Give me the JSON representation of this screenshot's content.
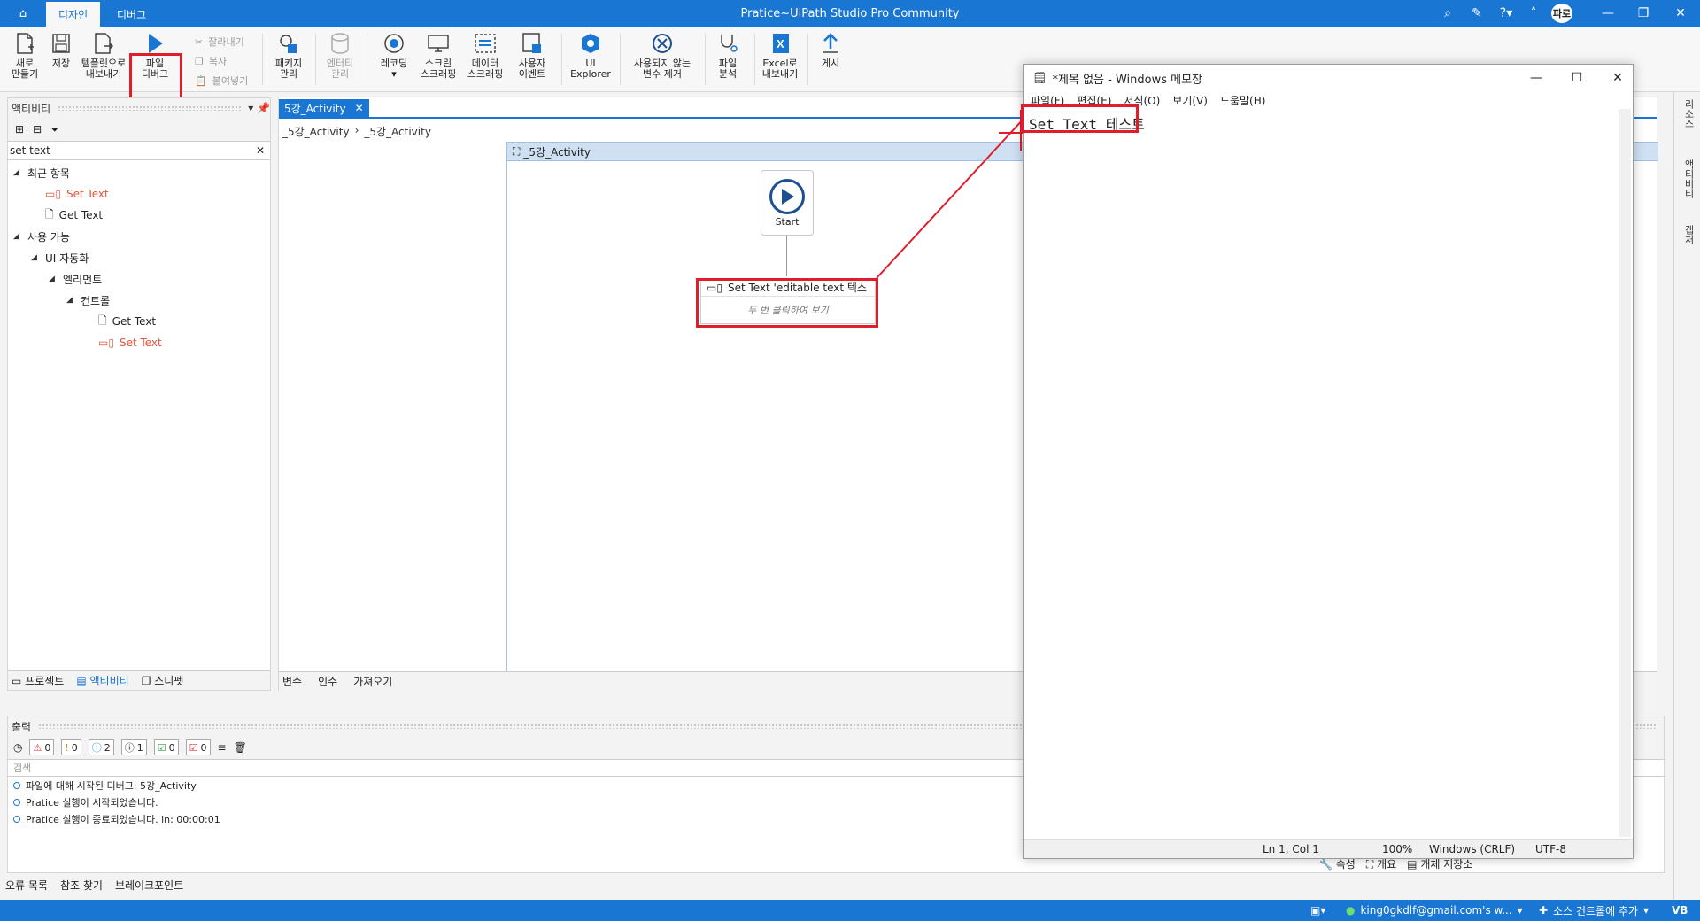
{
  "app": {
    "home_icon": "home-icon",
    "tabs": [
      "디자인",
      "디버그"
    ],
    "title": "Pratice~UiPath Studio Pro Community",
    "avatar": "파로"
  },
  "ribbon": {
    "new": "새로\n만들기",
    "save": "저장",
    "export_template": "템플릿으로\n내보내기",
    "debug_file": "파일\n디버그",
    "cut": "잘라내기",
    "copy": "복사",
    "paste": "붙여넣기",
    "manage_packages": "패키지\n관리",
    "manage_entities": "엔터티\n관리",
    "recording": "레코딩",
    "screen_scraping": "스크린\n스크래핑",
    "data_scraping": "데이터\n스크래핑",
    "user_events": "사용자\n이벤트",
    "ui_explorer": "UI\nExplorer",
    "remove_unused": "사용되지 않는\n변수 제거",
    "analyze_file": "파일\n분석",
    "export_excel": "Excel로\n내보내기",
    "publish": "게시"
  },
  "activities_panel": {
    "title": "액티비티",
    "search_value": "set text",
    "tree": [
      {
        "label": "최근 항목"
      },
      {
        "label": "Set Text"
      },
      {
        "label": "Get Text"
      },
      {
        "label": "사용 가능"
      },
      {
        "label": "UI 자동화"
      },
      {
        "label": "엘리먼트"
      },
      {
        "label": "컨트롤"
      },
      {
        "label": "Get Text"
      },
      {
        "label": "Set Text"
      }
    ],
    "bottom_tabs": [
      "프로젝트",
      "액티비티",
      "스니펫"
    ]
  },
  "designer": {
    "doc_tab": "5강_Activity",
    "breadcrumb": [
      "_5강_Activity",
      "_5강_Activity"
    ],
    "sequence_title": "_5강_Activity",
    "start_label": "Start",
    "activity_title": "Set Text 'editable text  텍스",
    "activity_hint": "두 번 클릭하여 보기",
    "bottom_tabs": [
      "변수",
      "인수",
      "가져오기"
    ]
  },
  "output": {
    "title": "출력",
    "counts": {
      "error": "0",
      "warning": "0",
      "info": "2",
      "trace": "1",
      "success": "0",
      "failed": "0"
    },
    "search_placeholder": "검색",
    "logs": [
      "파일에 대해 시작된 디버그: 5강_Activity",
      "Pratice 실행이 시작되었습니다.",
      "Pratice 실행이 종료되었습니다. in: 00:00:01"
    ],
    "bottom_tabs": [
      "오류 목록",
      "참조 찾기",
      "브레이크포인트"
    ],
    "right_tabs": [
      "속성",
      "개요",
      "개체 저장소"
    ]
  },
  "right_dock": [
    "리소스",
    "액티비티",
    "캡처"
  ],
  "statusbar": {
    "account": "king0gkdlf@gmail.com's w...",
    "source_control": "소스 컨트롤에 추가",
    "lang": "VB"
  },
  "notepad": {
    "title": "*제목 없음 - Windows 메모장",
    "menu": [
      "파일(F)",
      "편집(E)",
      "서식(O)",
      "보기(V)",
      "도움말(H)"
    ],
    "text": "Set Text 테스트",
    "status": {
      "position": "Ln 1, Col 1",
      "zoom": "100%",
      "eol": "Windows (CRLF)",
      "encoding": "UTF-8"
    }
  },
  "colors": {
    "accent": "#1976d2",
    "annotation_red": "#e01e2b",
    "recent_item": "#e5533d"
  }
}
